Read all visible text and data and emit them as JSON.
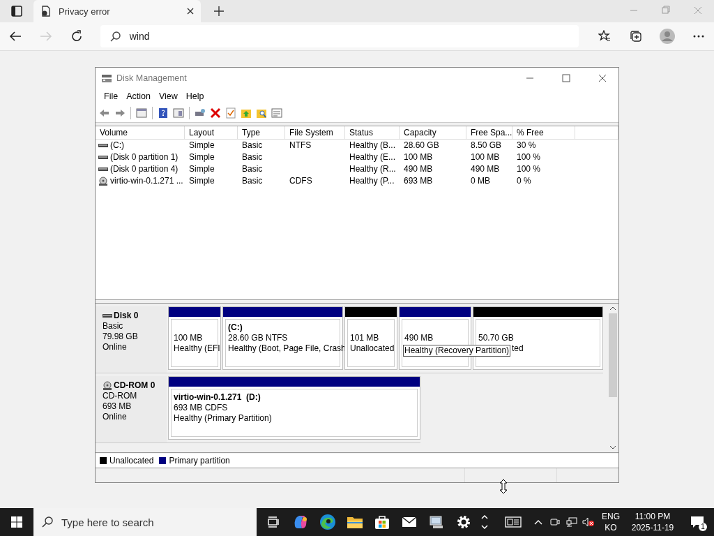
{
  "browser": {
    "tab_title": "Privacy error",
    "address": "wind"
  },
  "window": {
    "title": "Disk Management",
    "menu": [
      "File",
      "Action",
      "View",
      "Help"
    ],
    "columns": [
      "Volume",
      "Layout",
      "Type",
      "File System",
      "Status",
      "Capacity",
      "Free Spa...",
      "% Free"
    ],
    "rows": [
      {
        "kind": "disk",
        "volume": "(C:)",
        "layout": "Simple",
        "type": "Basic",
        "file_system": "NTFS",
        "status": "Healthy (B...",
        "capacity": "28.60 GB",
        "free_space": "8.50 GB",
        "percent_free": "30 %"
      },
      {
        "kind": "disk",
        "volume": "(Disk 0 partition 1)",
        "layout": "Simple",
        "type": "Basic",
        "file_system": "",
        "status": "Healthy (E...",
        "capacity": "100 MB",
        "free_space": "100 MB",
        "percent_free": "100 %"
      },
      {
        "kind": "disk",
        "volume": "(Disk 0 partition 4)",
        "layout": "Simple",
        "type": "Basic",
        "file_system": "",
        "status": "Healthy (R...",
        "capacity": "490 MB",
        "free_space": "490 MB",
        "percent_free": "100 %"
      },
      {
        "kind": "cdrom",
        "volume": "virtio-win-0.1.271 ...",
        "layout": "Simple",
        "type": "Basic",
        "file_system": "CDFS",
        "status": "Healthy (P...",
        "capacity": "693 MB",
        "free_space": "0 MB",
        "percent_free": "0 %"
      }
    ],
    "disks": [
      {
        "kind": "disk",
        "name": "Disk 0",
        "type": "Basic",
        "size": "79.98 GB",
        "state": "Online",
        "partitions": [
          {
            "kind": "primary",
            "size": "100 MB",
            "status": "Healthy (EFI"
          },
          {
            "kind": "primary",
            "title": "(C:)",
            "size": "28.60 GB NTFS",
            "status": "Healthy (Boot, Page File, Crash"
          },
          {
            "kind": "unallocated",
            "size": "101 MB",
            "status": "Unallocated"
          },
          {
            "kind": "primary",
            "size": "490 MB",
            "tooltip": "Healthy (Recovery Partition)"
          },
          {
            "kind": "unallocated",
            "size": "50.70 GB",
            "status": "ted"
          }
        ]
      },
      {
        "kind": "cdrom",
        "name": "CD-ROM 0",
        "type": "CD-ROM",
        "size": "693 MB",
        "state": "Online",
        "partitions": [
          {
            "kind": "primary",
            "title": "virtio-win-0.1.271  (D:)",
            "size": "693 MB CDFS",
            "status": "Healthy (Primary Partition)"
          }
        ]
      }
    ],
    "legend": [
      {
        "kind": "unallocated",
        "label": "Unallocated"
      },
      {
        "kind": "primary",
        "label": "Primary partition"
      }
    ]
  },
  "taskbar": {
    "search_placeholder": "Type here to search",
    "language": "ENG",
    "region": "KO",
    "time": "11:00 PM",
    "date": "2025-11-19",
    "notifications": "1"
  }
}
